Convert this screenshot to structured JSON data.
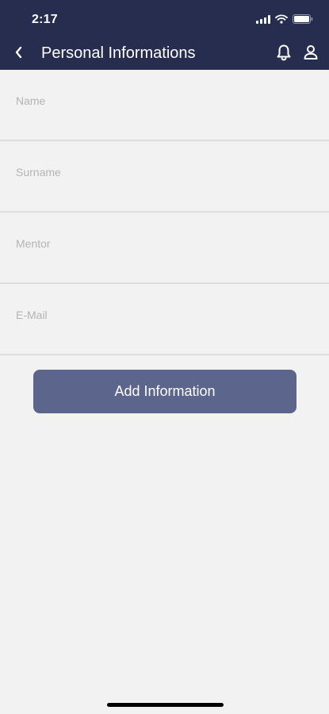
{
  "status_bar": {
    "time": "2:17",
    "icons": [
      "signal-icon",
      "wifi-icon",
      "battery-icon"
    ]
  },
  "nav_bar": {
    "title": "Personal Informations",
    "back_icon": "chevron-left-icon",
    "actions": [
      "bell-icon",
      "user-icon"
    ]
  },
  "form": {
    "fields": [
      {
        "label": "Name",
        "value": ""
      },
      {
        "label": "Surname",
        "value": ""
      },
      {
        "label": "Mentor",
        "value": ""
      },
      {
        "label": "E-Mail",
        "value": ""
      }
    ],
    "submit_label": "Add Information"
  },
  "colors": {
    "header_bg": "#262d4f",
    "page_bg": "#f2f2f2",
    "button_bg": "#5c658c",
    "label": "#b4b4b4",
    "divider": "#dedede"
  }
}
